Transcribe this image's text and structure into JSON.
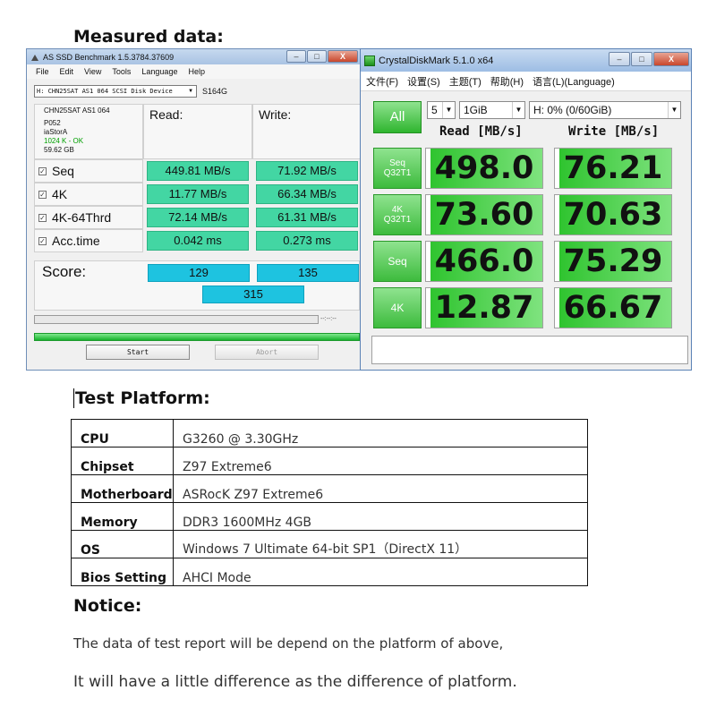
{
  "headings": {
    "measured": "Measured data:",
    "platform": "Test Platform:",
    "notice": "Notice:"
  },
  "asssd": {
    "title": "AS SSD Benchmark 1.5.3784.37609",
    "window_buttons": [
      "–",
      "□",
      "X"
    ],
    "menu": [
      "File",
      "Edit",
      "View",
      "Tools",
      "Language",
      "Help"
    ],
    "drive_select": "H: CHN25SAT AS1 064 SCSI Disk Device",
    "drive_model": "S164G",
    "info": [
      "CHN25SAT AS1 064",
      "P052",
      "iaStorA",
      "1024 K - OK",
      "59.62 GB"
    ],
    "info_ok_color": "#00a000",
    "read_header": "Read:",
    "write_header": "Write:",
    "rows": [
      {
        "label": "Seq",
        "read": "449.81 MB/s",
        "write": "71.92 MB/s"
      },
      {
        "label": "4K",
        "read": "11.77 MB/s",
        "write": "66.34 MB/s"
      },
      {
        "label": "4K-64Thrd",
        "read": "72.14 MB/s",
        "write": "61.31 MB/s"
      },
      {
        "label": "Acc.time",
        "read": "0.042 ms",
        "write": "0.273 ms"
      }
    ],
    "score_label": "Score:",
    "score_read": "129",
    "score_write": "135",
    "score_total": "315",
    "progress_time": "--:--:--",
    "start_label": "Start",
    "abort_label": "Abort",
    "cell_color": "#43d6a3",
    "score_color": "#1ec3e0"
  },
  "cdm": {
    "title": "CrystalDiskMark 5.1.0 x64",
    "window_buttons": [
      "–",
      "□",
      "X"
    ],
    "menu": [
      "文件(F)",
      "设置(S)",
      "主题(T)",
      "帮助(H)",
      "语言(L)(Language)"
    ],
    "all_label": "All",
    "count": "5",
    "size": "1GiB",
    "drive": "H: 0% (0/60GiB)",
    "read_header": "Read [MB/s]",
    "write_header": "Write [MB/s]",
    "tests": [
      {
        "line1": "Seq",
        "line2": "Q32T1",
        "read": "498.0",
        "write": "76.21"
      },
      {
        "line1": "4K",
        "line2": "Q32T1",
        "read": "73.60",
        "write": "70.63"
      },
      {
        "line1": "Seq",
        "line2": "",
        "read": "466.0",
        "write": "75.29"
      },
      {
        "line1": "4K",
        "line2": "",
        "read": "12.87",
        "write": "66.67"
      }
    ],
    "bar_color": "#2fc42f"
  },
  "platform": [
    {
      "key": "CPU",
      "value": "G3260 @ 3.30GHz"
    },
    {
      "key": "Chipset",
      "value": "Z97 Extreme6"
    },
    {
      "key": "Motherboard",
      "value": "ASRocK Z97 Extreme6"
    },
    {
      "key": "Memory",
      "value": "DDR3 1600MHz 4GB"
    },
    {
      "key": "OS",
      "value": "Windows 7 Ultimate 64-bit SP1（DirectX 11）"
    },
    {
      "key": "Bios Setting",
      "value": "AHCI Mode"
    }
  ],
  "notice": {
    "line1": "The data of test report will be depend on the platform of above,",
    "line2": "It will have a little difference as the difference of platform."
  }
}
